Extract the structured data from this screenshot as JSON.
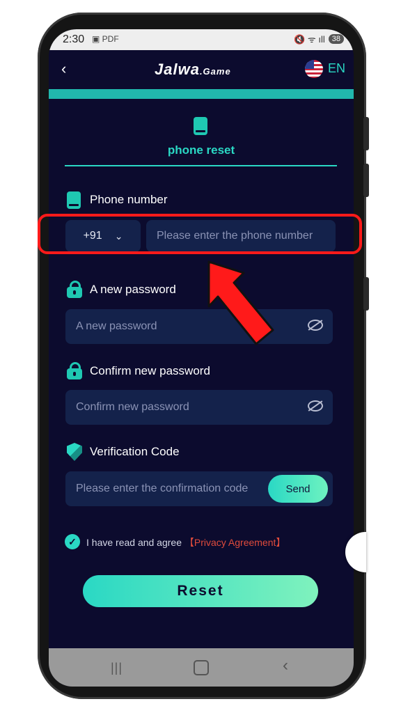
{
  "status_bar": {
    "time": "2:30",
    "left_icons": "▣ PDF",
    "right_icons": "🔇 ᯤ ıll",
    "battery": "38"
  },
  "header": {
    "back_icon": "back-icon",
    "logo_main": "Jalwa",
    "logo_suffix": ".Game",
    "language": "EN"
  },
  "tab": {
    "label": "phone reset"
  },
  "form": {
    "phone_label": "Phone number",
    "country_code": "+91",
    "phone_placeholder": "Please enter the phone number",
    "new_password_label": "A new password",
    "new_password_placeholder": "A new password",
    "confirm_password_label": "Confirm new password",
    "confirm_password_placeholder": "Confirm new password",
    "verification_label": "Verification Code",
    "verification_placeholder": "Please enter the confirmation code",
    "send_label": "Send",
    "agree_text": "I have read and agree",
    "privacy_link": "【Privacy Agreement】",
    "reset_label": "Reset"
  },
  "colors": {
    "background": "#0c0b2e",
    "accent": "#2ad8c4",
    "input_bg": "#14224b",
    "link": "#e04b3c",
    "highlight": "#ff1a1a"
  }
}
